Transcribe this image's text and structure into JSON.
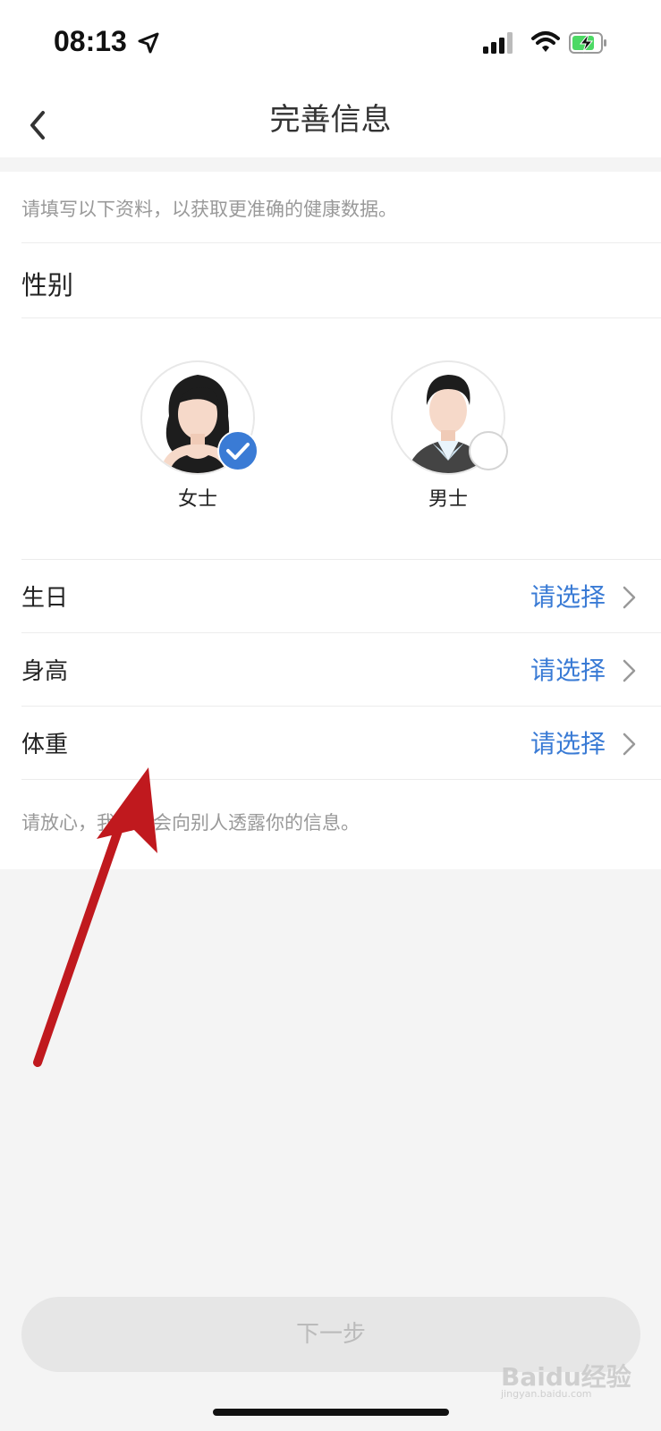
{
  "status_bar": {
    "time": "08:13",
    "icons": [
      "location-arrow-icon",
      "signal-icon",
      "wifi-icon",
      "battery-charging-icon"
    ],
    "battery_color": "#4cd964"
  },
  "header": {
    "title": "完善信息",
    "back_icon": "chevron-left-icon"
  },
  "form": {
    "intro": "请填写以下资料，以获取更准确的健康数据。",
    "gender": {
      "label": "性别",
      "options": [
        {
          "label": "女士",
          "selected": true
        },
        {
          "label": "男士",
          "selected": false
        }
      ]
    },
    "rows": [
      {
        "label": "生日",
        "value": "请选择"
      },
      {
        "label": "身高",
        "value": "请选择"
      },
      {
        "label": "体重",
        "value": "请选择"
      }
    ],
    "reassure": "请放心，我们不会向别人透露你的信息。"
  },
  "footer": {
    "next_label": "下一步"
  },
  "watermark": {
    "text": "Baidu经验",
    "sub": "jingyan.baidu.com"
  },
  "colors": {
    "accent": "#3a7bd5",
    "annotation_arrow": "#c0191e",
    "button_disabled_bg": "#e6e6e6"
  }
}
